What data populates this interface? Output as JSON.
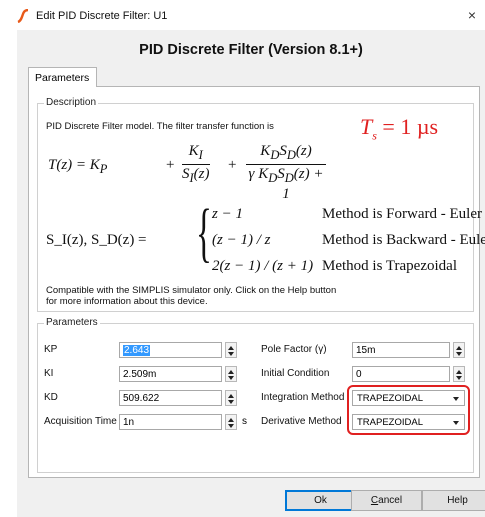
{
  "window": {
    "title": "Edit PID Discrete Filter: U1",
    "close_glyph": "×",
    "icon": "simplis-icon"
  },
  "header": {
    "heading": "PID Discrete Filter (Version 8.1+)"
  },
  "tabs": [
    {
      "label": "Parameters",
      "selected": true
    }
  ],
  "description": {
    "legend": "Description",
    "intro": "PID Discrete Filter model. The filter transfer function is",
    "sample_time_annotation": {
      "symbol": "T",
      "subscript": "s",
      "value": "= 1 µs",
      "color": "#e02020"
    },
    "transfer_function": {
      "lhs": "T(z) = K",
      "lhs_sub": "P",
      "term1_num": "K",
      "term1_num_sub": "I",
      "term1_den": "S",
      "term1_den_sub": "I",
      "term1_den_arg": "(z)",
      "term2_num": "K",
      "term2_num_sub": "D",
      "term2_num_s": "S",
      "term2_num_s_sub": "D",
      "term2_num_arg": "(z)",
      "term2_den": "γ K",
      "term2_den_sub": "D",
      "term2_den_s": "S",
      "term2_den_s_sub": "D",
      "term2_den_tail": "(z) + 1",
      "plus": "+"
    },
    "cases": {
      "lhs": "S_I(z),   S_D(z) =",
      "rows": [
        {
          "expr": "z − 1",
          "cond": "Method is Forward - Euler"
        },
        {
          "expr": "(z − 1) / z",
          "cond": "Method is Backward - Euler"
        },
        {
          "expr": "2(z − 1) / (z + 1)",
          "cond": "Method is Trapezoidal"
        }
      ]
    },
    "compat_line1": "Compatible with the SIMPLIS simulator only. Click on the Help button",
    "compat_line2": "for more information about this device."
  },
  "parameters": {
    "legend": "Parameters",
    "left_fields": [
      {
        "label": "KP",
        "value": "2.643",
        "selected": true
      },
      {
        "label": "KI",
        "value": "2.509m"
      },
      {
        "label": "KD",
        "value": "509.622"
      },
      {
        "label": "Acquisition Time",
        "value": "1n",
        "unit": "s"
      }
    ],
    "right_fields": [
      {
        "label": "Pole Factor (γ)",
        "value": "15m"
      },
      {
        "label": "Initial Condition",
        "value": "0"
      }
    ],
    "combos": [
      {
        "label": "Integration Method",
        "value": "TRAPEZOIDAL"
      },
      {
        "label": "Derivative Method",
        "value": "TRAPEZOIDAL"
      }
    ],
    "highlight_color": "#e02020"
  },
  "buttons": {
    "ok": "Ok",
    "cancel_first": "C",
    "cancel_rest": "ancel",
    "help": "Help"
  }
}
